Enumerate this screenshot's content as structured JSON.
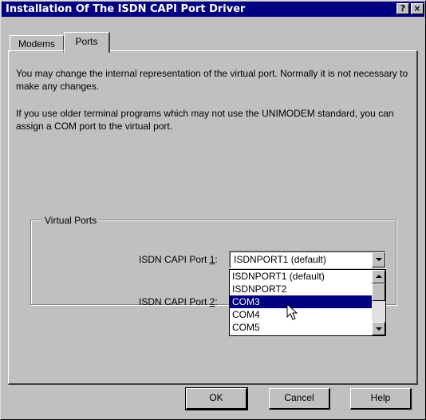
{
  "window": {
    "title": "Installation Of The ISDN CAPI Port Driver",
    "help_glyph": "?",
    "close_glyph": "×"
  },
  "tabs": [
    {
      "label": "Modems",
      "active": false
    },
    {
      "label": "Ports",
      "active": true
    }
  ],
  "content": {
    "paragraph1": "You may change the internal representation of the virtual port. Normally it is not necessary to make any changes.",
    "paragraph2": "If you use older terminal programs which may not use the UNIMODEM standard, you can assign a COM port to the virtual port."
  },
  "virtual_ports": {
    "group_label": "Virtual Ports",
    "port1_label_prefix": "ISDN CAPI Port ",
    "port1_label_key": "1",
    "port1_label_suffix": ":",
    "port1_value": "ISDNPORT1 (default)",
    "port2_label_prefix": "ISDN CAPI Port ",
    "port2_label_key": "2",
    "port2_label_suffix": ":",
    "dropdown_options": [
      {
        "label": "ISDNPORT1 (default)",
        "selected": false
      },
      {
        "label": "ISDNPORT2",
        "selected": false
      },
      {
        "label": "COM3",
        "selected": true
      },
      {
        "label": "COM4",
        "selected": false
      },
      {
        "label": "COM5",
        "selected": false
      }
    ]
  },
  "buttons": {
    "ok": "OK",
    "cancel": "Cancel",
    "help": "Help"
  },
  "colors": {
    "titlebar": "#000080",
    "face": "#c0c0c0",
    "highlight": "#000080"
  },
  "icons": {
    "help": "question-mark-icon",
    "close": "close-icon",
    "cursor": "arrow-cursor-icon"
  }
}
